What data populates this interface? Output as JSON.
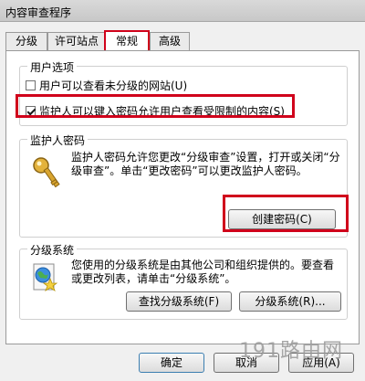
{
  "window": {
    "title": "内容审查程序"
  },
  "tabs": [
    {
      "label": "分级",
      "active": false
    },
    {
      "label": "许可站点",
      "active": false
    },
    {
      "label": "常规",
      "active": true
    },
    {
      "label": "高级",
      "active": false
    }
  ],
  "user_options": {
    "legend": "用户选项",
    "option1": {
      "label": "用户可以查看未分级的网站(U)",
      "checked": false
    },
    "option2": {
      "label": "监护人可以键入密码允许用户查看受限制的内容(S)",
      "checked": true
    }
  },
  "supervisor_password": {
    "legend": "监护人密码",
    "description": "监护人密码允许您更改“分级审查”设置，打开或关闭“分级审查”。单击“更改密码”可以更改监护人密码。",
    "create_button": "创建密码(C)"
  },
  "rating_systems": {
    "legend": "分级系统",
    "description": "您使用的分级系统是由其他公司和组织提供的。要查看或更改列表，请单击“分级系统”。",
    "find_button": "查找分级系统(F)",
    "systems_button": "分级系统(R)..."
  },
  "footer": {
    "ok": "确定",
    "cancel": "取消",
    "apply": "应用(A)"
  },
  "watermark": "191路由网",
  "colors": {
    "highlight": "#d0021b"
  }
}
